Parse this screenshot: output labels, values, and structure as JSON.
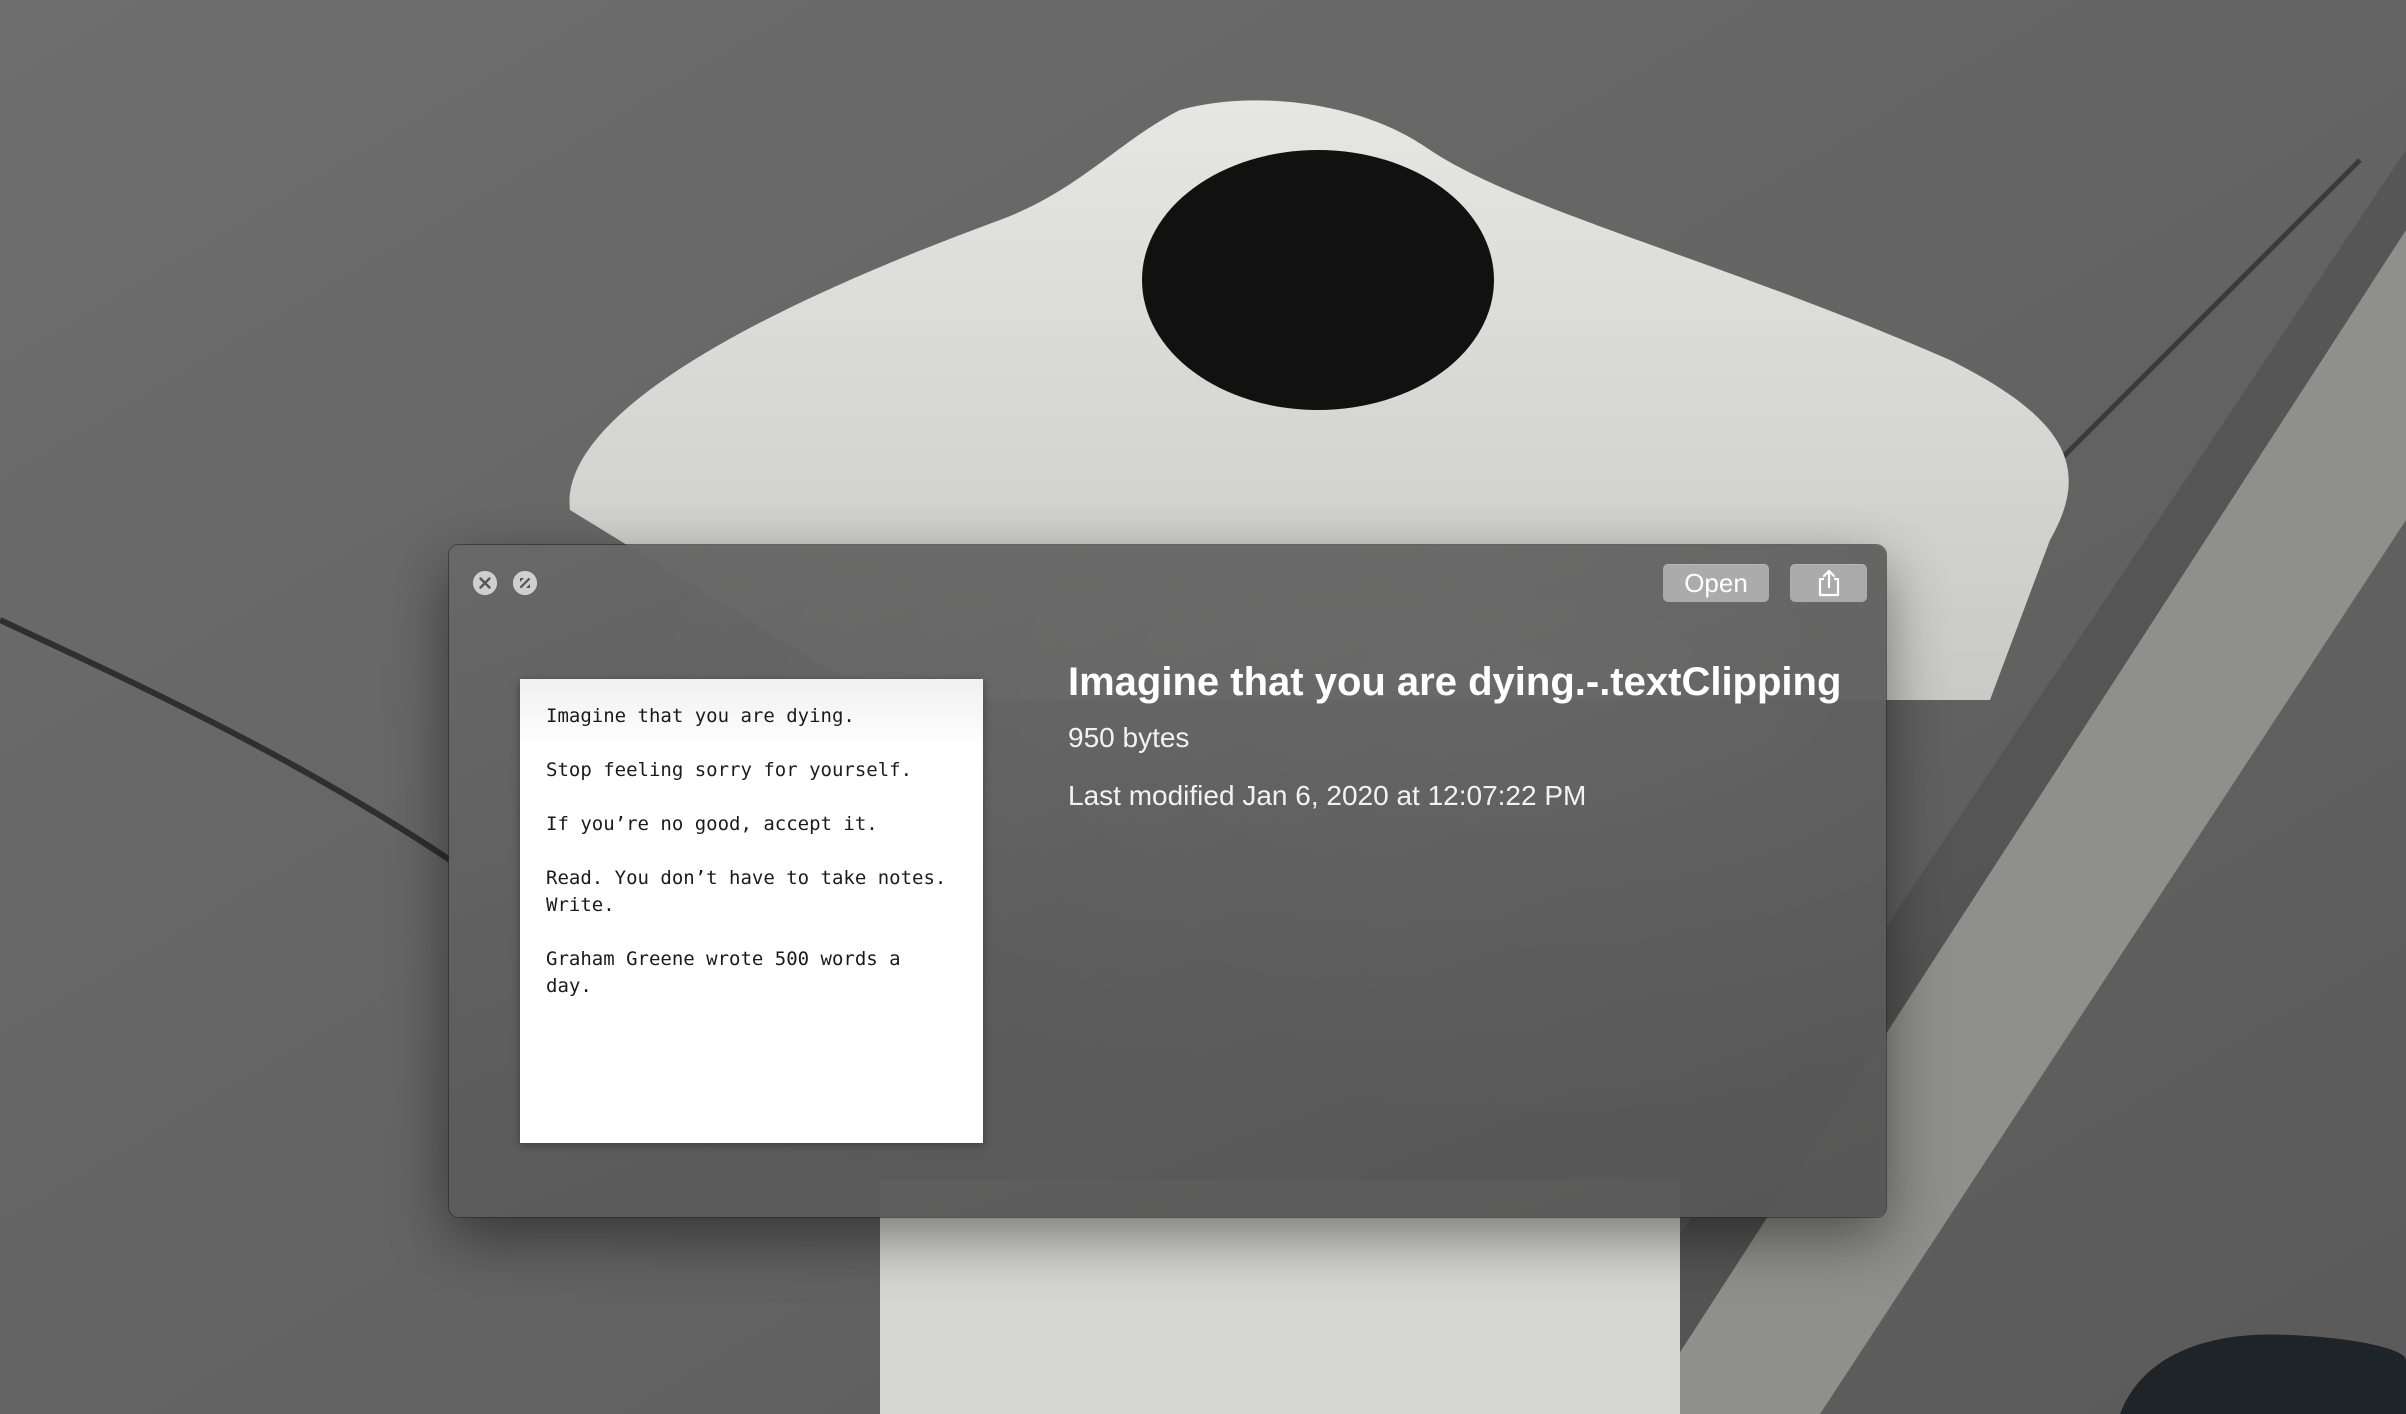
{
  "window": {
    "buttons": {
      "open_label": "Open",
      "share_icon": "share-icon",
      "close_icon": "close-icon",
      "fullscreen_icon": "fullscreen-icon"
    }
  },
  "preview": {
    "lines": [
      "Imagine that you are dying.",
      "Stop feeling sorry for yourself.",
      "If you’re no good, accept it.",
      "Read. You don’t have to take notes.\nWrite.",
      "Graham Greene wrote 500 words a\nday."
    ]
  },
  "file": {
    "name": "Imagine that you are dying.-.textClipping",
    "size": "950 bytes",
    "modified": "Last modified Jan 6, 2020 at 12:07:22 PM"
  },
  "colors": {
    "window_bg": "#5e5e5e",
    "button_bg": "#a8a8a8",
    "text": "#ffffff"
  }
}
